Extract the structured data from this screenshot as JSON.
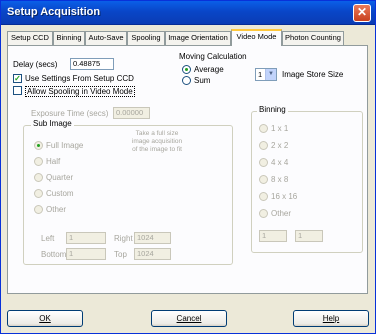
{
  "window": {
    "title": "Setup Acquisition",
    "close_glyph": "✕"
  },
  "tabs": [
    {
      "label": "Setup CCD",
      "active": false
    },
    {
      "label": "Binning",
      "active": false
    },
    {
      "label": "Auto-Save",
      "active": false
    },
    {
      "label": "Spooling",
      "active": false
    },
    {
      "label": "Image Orientation",
      "active": false
    },
    {
      "label": "Video Mode",
      "active": true
    },
    {
      "label": "Photon Counting",
      "active": false
    }
  ],
  "video_mode": {
    "delay_label": "Delay (secs)",
    "delay_value": "0.48875",
    "use_settings_label": "Use Settings From Setup CCD",
    "use_settings_checked": true,
    "allow_spooling_label": "Allow Spooling in Video Mode",
    "allow_spooling_checked": false,
    "moving_calc_label": "Moving Calculation",
    "average_label": "Average",
    "sum_label": "Sum",
    "selected_calc": "Average",
    "image_store_value": "1",
    "image_store_label": "Image Store Size",
    "exposure_label": "Exposure Time (secs)",
    "exposure_value": "0.00000",
    "sub_image": {
      "title": "Sub Image",
      "options": [
        "Full Image",
        "Half",
        "Quarter",
        "Custom",
        "Other"
      ],
      "selected": "Full Image",
      "note": "Take a full size image acquisition of the image to fit",
      "fields": {
        "left_label": "Left",
        "left_value": "1",
        "right_label": "Right",
        "right_value": "1024",
        "bottom_label": "Bottom",
        "bottom_value": "1",
        "top_label": "Top",
        "top_value": "1024"
      }
    },
    "binning": {
      "title": "Binning",
      "options": [
        "1 x 1",
        "2 x 2",
        "4 x 4",
        "8 x 8",
        "16 x 16",
        "Other"
      ],
      "h_value": "1",
      "v_value": "1"
    }
  },
  "buttons": {
    "ok": "OK",
    "cancel": "Cancel",
    "help": "Help"
  }
}
